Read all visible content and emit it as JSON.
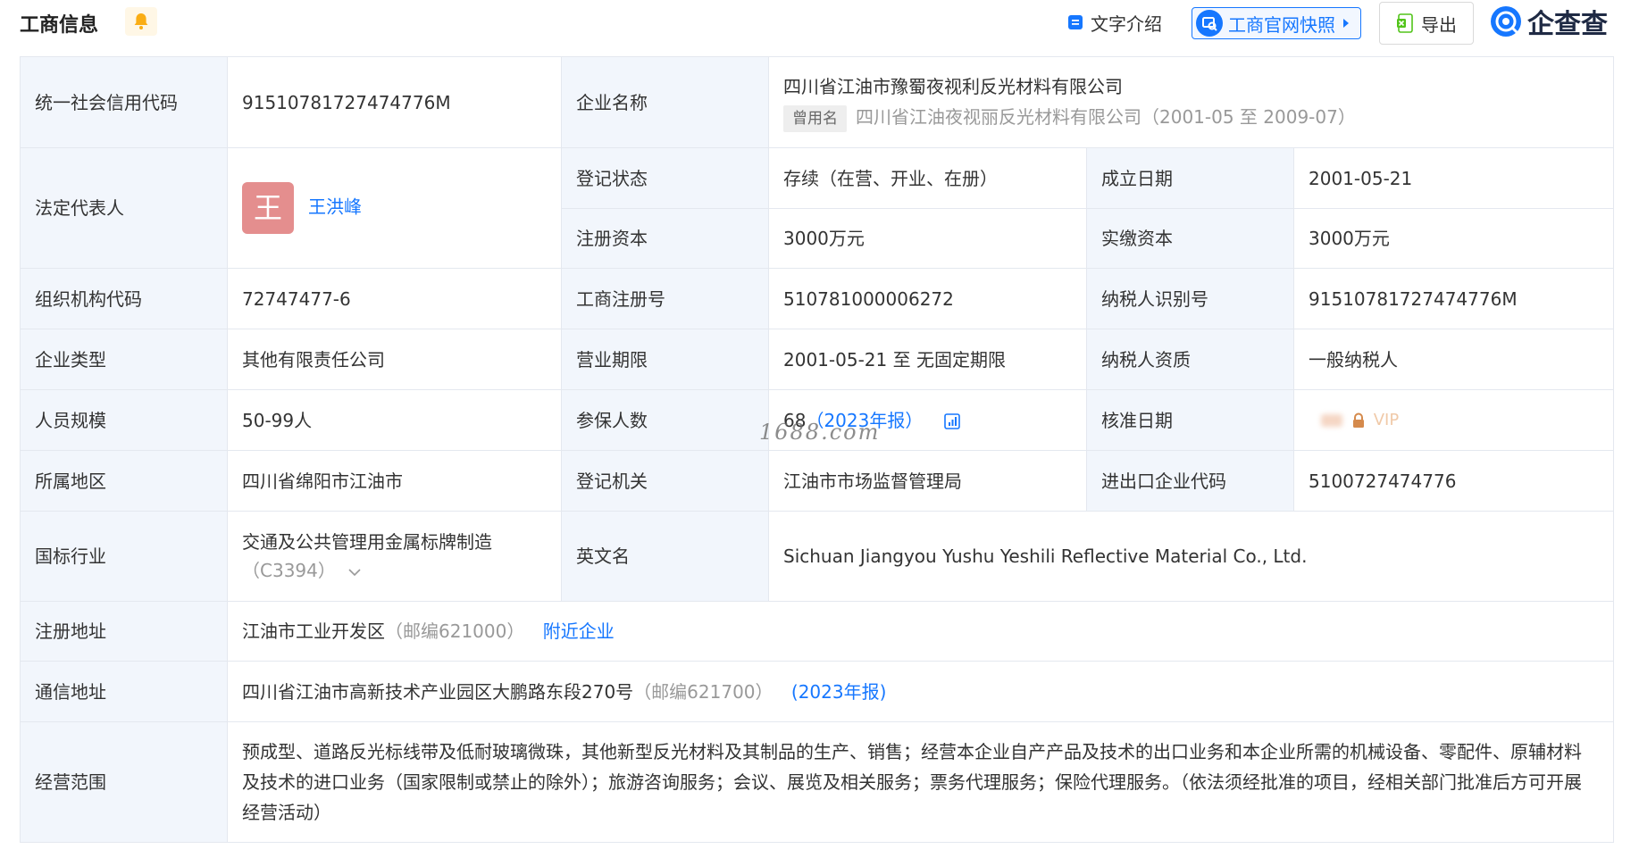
{
  "header": {
    "title": "工商信息",
    "intro_label": "文字介绍",
    "snapshot_label": "工商官网快照",
    "export_label": "导出",
    "logo_text": "企查查"
  },
  "rows": {
    "credit_code": {
      "label": "统一社会信用代码",
      "value": "91510781727474776M"
    },
    "company_name": {
      "label": "企业名称",
      "value": "四川省江油市豫蜀夜视利反光材料有限公司",
      "former_tag": "曾用名",
      "former_name": "四川省江油夜视丽反光材料有限公司（2001-05 至 2009-07）"
    },
    "legal_rep": {
      "label": "法定代表人",
      "avatar_char": "王",
      "name": "王洪峰"
    },
    "reg_status": {
      "label": "登记状态",
      "value": "存续（在营、开业、在册）"
    },
    "found_date": {
      "label": "成立日期",
      "value": "2001-05-21"
    },
    "reg_capital": {
      "label": "注册资本",
      "value": "3000万元"
    },
    "paid_capital": {
      "label": "实缴资本",
      "value": "3000万元"
    },
    "org_code": {
      "label": "组织机构代码",
      "value": "72747477-6"
    },
    "biz_reg_no": {
      "label": "工商注册号",
      "value": "510781000006272"
    },
    "taxpayer_id": {
      "label": "纳税人识别号",
      "value": "91510781727474776M"
    },
    "company_type": {
      "label": "企业类型",
      "value": "其他有限责任公司"
    },
    "biz_term": {
      "label": "营业期限",
      "value": "2001-05-21 至 无固定期限"
    },
    "taxpayer_qual": {
      "label": "纳税人资质",
      "value": "一般纳税人"
    },
    "staff_size": {
      "label": "人员规模",
      "value": "50-99人"
    },
    "insured": {
      "label": "参保人数",
      "value": "68",
      "report": "（2023年报）"
    },
    "approve_date": {
      "label": "核准日期",
      "vip": "VIP"
    },
    "region": {
      "label": "所属地区",
      "value": "四川省绵阳市江油市"
    },
    "reg_authority": {
      "label": "登记机关",
      "value": "江油市市场监督管理局"
    },
    "import_export_code": {
      "label": "进出口企业代码",
      "value": "5100727474776"
    },
    "industry": {
      "label": "国标行业",
      "value": "交通及公共管理用金属标牌制造",
      "code": "（C3394）"
    },
    "english_name": {
      "label": "英文名",
      "value": "Sichuan Jiangyou Yushu Yeshili Reflective Material Co., Ltd."
    },
    "reg_address": {
      "label": "注册地址",
      "value": "江油市工业开发区",
      "postcode": "（邮编621000）",
      "nearby": "附近企业"
    },
    "mail_address": {
      "label": "通信地址",
      "value": "四川省江油市高新技术产业园区大鹏路东段270号",
      "postcode": "（邮编621700）",
      "report": "(2023年报)"
    },
    "biz_scope": {
      "label": "经营范围",
      "value": "预成型、道路反光标线带及低耐玻璃微珠，其他新型反光材料及其制品的生产、销售；经营本企业自产产品及技术的出口业务和本企业所需的机械设备、零配件、原辅材料及技术的进口业务（国家限制或禁止的除外）；旅游咨询服务；会议、展览及相关服务；票务代理服务；保险代理服务。（依法须经批准的项目，经相关部门批准后方可开展经营活动）"
    }
  },
  "watermark": "1688.com",
  "colors": {
    "accent": "#1677ff",
    "label_bg": "#f2f6fc",
    "avatar_bg": "#e48e8e"
  }
}
